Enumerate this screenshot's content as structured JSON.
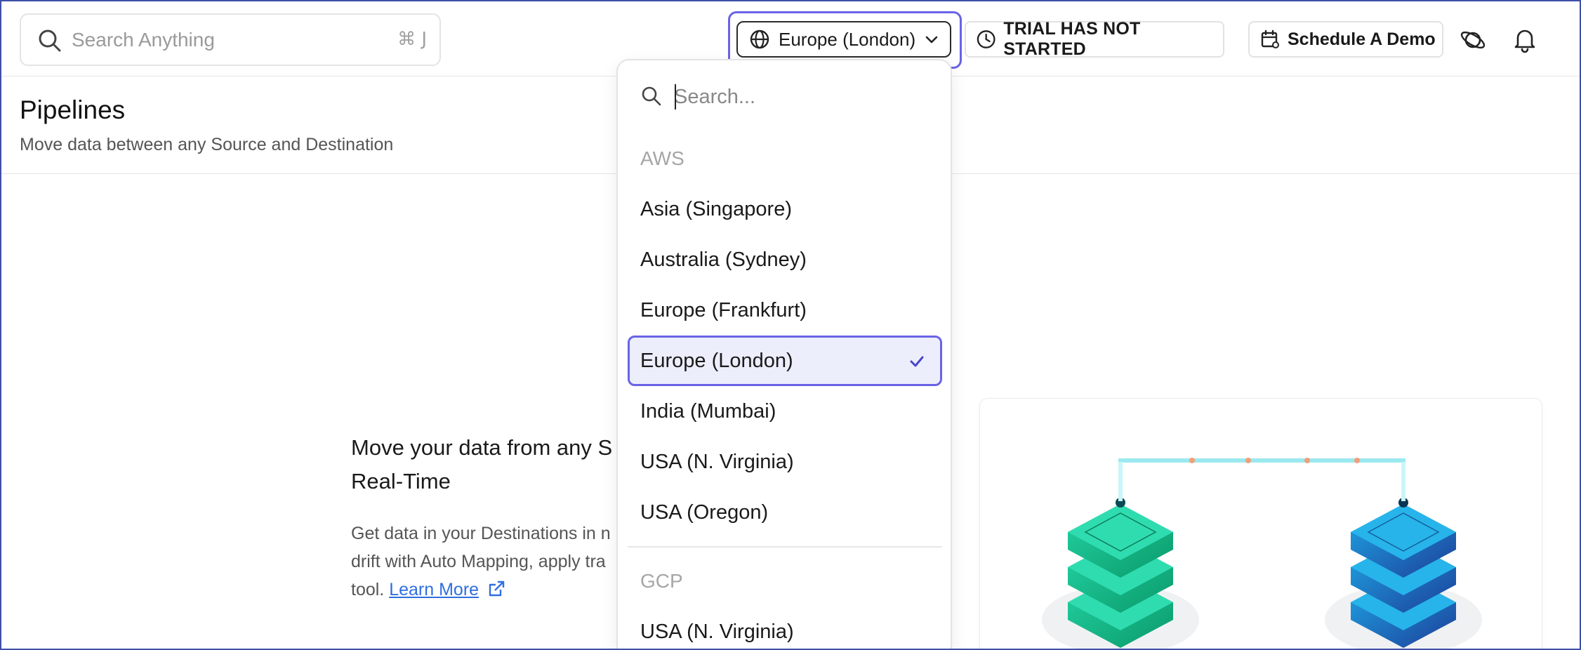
{
  "topbar": {
    "search_placeholder": "Search Anything",
    "search_shortcut": "⌘ J",
    "region_label": "Europe (London)",
    "trial_label": "TRIAL HAS NOT STARTED",
    "demo_label": "Schedule A Demo"
  },
  "page": {
    "title": "Pipelines",
    "subtitle": "Move data between any Source and Destination"
  },
  "hero": {
    "title_line1": "Move your data from any S",
    "title_line2": "Real-Time",
    "text_line1": "Get data in your Destinations in n",
    "text_line2": "drift with Auto Mapping, apply tra",
    "text_line3_prefix": "tool.",
    "learn_more": "Learn More"
  },
  "dropdown": {
    "search_placeholder": "Search...",
    "groups": [
      {
        "label": "AWS",
        "options": [
          "Asia (Singapore)",
          "Australia (Sydney)",
          "Europe (Frankfurt)",
          "Europe (London)",
          "India (Mumbai)",
          "USA (N. Virginia)",
          "USA (Oregon)"
        ]
      },
      {
        "label": "GCP",
        "options": [
          "USA (N. Virginia)"
        ]
      }
    ],
    "selected": "Europe (London)"
  },
  "colors": {
    "accent": "#6a63e6",
    "link": "#2f6fe0",
    "frame": "#3d4fa8"
  },
  "icons": {
    "search": "search-icon",
    "globe": "globe-icon",
    "chevron": "chevron-down-icon",
    "clock": "clock-icon",
    "calendar": "calendar-icon",
    "planet": "planet-icon",
    "bell": "bell-icon",
    "external": "external-link-icon",
    "check": "check-icon"
  }
}
